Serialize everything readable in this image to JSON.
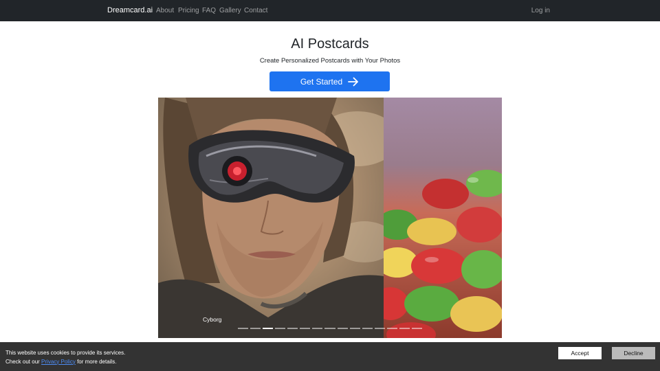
{
  "navbar": {
    "brand": "Dreamcard.ai",
    "links": [
      "About",
      "Pricing",
      "FAQ",
      "Gallery",
      "Contact"
    ],
    "login": "Log in"
  },
  "hero": {
    "title": "AI Postcards",
    "subtitle": "Create Personalized Postcards with Your Photos",
    "cta_label": "Get Started",
    "cta_icon": "arrow-right-icon",
    "accent_color": "#1e73f0"
  },
  "carousel": {
    "caption": "Cyborg",
    "slides": [
      "cyborg-portrait",
      "candy-closeup"
    ],
    "indicator_count": 15,
    "active_index": 2
  },
  "cookie": {
    "line1": "This website uses cookies to provide its services.",
    "line2_prefix": "Check out our",
    "link": "Privacy Policy",
    "line2_suffix": "for more details.",
    "accept": "Accept",
    "decline": "Decline"
  }
}
